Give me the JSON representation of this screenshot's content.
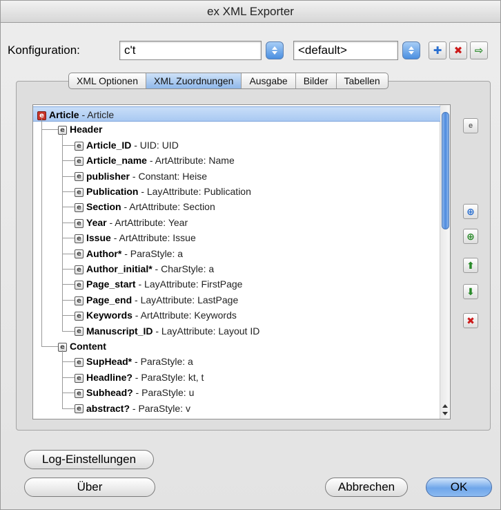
{
  "window": {
    "title": "ex XML Exporter"
  },
  "config": {
    "label": "Konfiguration:",
    "value": "c't",
    "default_value": "<default>"
  },
  "tabs": [
    {
      "label": "XML Optionen"
    },
    {
      "label": "XML Zuordnungen"
    },
    {
      "label": "Ausgabe"
    },
    {
      "label": "Bilder"
    },
    {
      "label": "Tabellen"
    }
  ],
  "tree": [
    {
      "name": "Article",
      "desc": " - Article",
      "level": 0
    },
    {
      "name": "Header",
      "desc": "",
      "level": 1
    },
    {
      "name": "Article_ID",
      "desc": " - UID: UID",
      "level": 2
    },
    {
      "name": "Article_name",
      "desc": " - ArtAttribute: Name",
      "level": 2
    },
    {
      "name": "publisher",
      "desc": " - Constant: Heise",
      "level": 2
    },
    {
      "name": "Publication",
      "desc": " - LayAttribute: Publication",
      "level": 2
    },
    {
      "name": "Section",
      "desc": " - ArtAttribute: Section",
      "level": 2
    },
    {
      "name": "Year",
      "desc": " - ArtAttribute: Year",
      "level": 2
    },
    {
      "name": "Issue",
      "desc": " - ArtAttribute: Issue",
      "level": 2
    },
    {
      "name": "Author*",
      "desc": " - ParaStyle: a",
      "level": 2
    },
    {
      "name": "Author_initial*",
      "desc": " - CharStyle: a",
      "level": 2
    },
    {
      "name": "Page_start",
      "desc": " - LayAttribute: FirstPage",
      "level": 2
    },
    {
      "name": "Page_end",
      "desc": " - LayAttribute: LastPage",
      "level": 2
    },
    {
      "name": "Keywords",
      "desc": " - ArtAttribute: Keywords",
      "level": 2
    },
    {
      "name": "Manuscript_ID",
      "desc": " - LayAttribute: Layout ID",
      "level": 2
    },
    {
      "name": "Content",
      "desc": "",
      "level": 1
    },
    {
      "name": "SupHead*",
      "desc": " - ParaStyle: a",
      "level": 2
    },
    {
      "name": "Headline?",
      "desc": " - ParaStyle: kt, t",
      "level": 2
    },
    {
      "name": "Subhead?",
      "desc": " - ParaStyle: u",
      "level": 2
    },
    {
      "name": "abstract?",
      "desc": " - ParaStyle: v",
      "level": 2
    }
  ],
  "icon_letter": "e",
  "buttons": {
    "log": "Log-Einstellungen",
    "about": "Über",
    "cancel": "Abbrechen",
    "ok": "OK"
  },
  "colors": {
    "accent": "#4a8fe0",
    "delete": "#cc1a1a",
    "move": "#2a8a2a"
  }
}
